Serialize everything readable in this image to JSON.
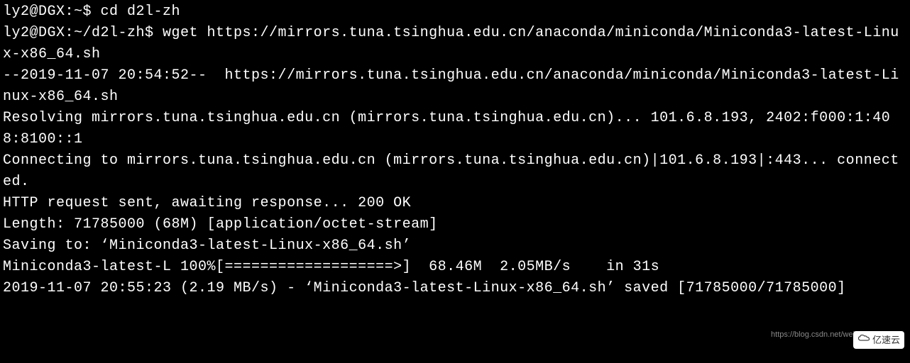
{
  "terminal": {
    "lines": [
      "ly2@DGX:~$ cd d2l-zh",
      "ly2@DGX:~/d2l-zh$ wget https://mirrors.tuna.tsinghua.edu.cn/anaconda/miniconda/Miniconda3-latest-Linux-x86_64.sh",
      "--2019-11-07 20:54:52--  https://mirrors.tuna.tsinghua.edu.cn/anaconda/miniconda/Miniconda3-latest-Linux-x86_64.sh",
      "Resolving mirrors.tuna.tsinghua.edu.cn (mirrors.tuna.tsinghua.edu.cn)... 101.6.8.193, 2402:f000:1:408:8100::1",
      "Connecting to mirrors.tuna.tsinghua.edu.cn (mirrors.tuna.tsinghua.edu.cn)|101.6.8.193|:443... connected.",
      "HTTP request sent, awaiting response... 200 OK",
      "Length: 71785000 (68M) [application/octet-stream]",
      "Saving to: ‘Miniconda3-latest-Linux-x86_64.sh’",
      "",
      "Miniconda3-latest-L 100%[===================>]  68.46M  2.05MB/s    in 31s",
      "",
      "2019-11-07 20:55:23 (2.19 MB/s) - ‘Miniconda3-latest-Linux-x86_64.sh’ saved [71785000/71785000]"
    ]
  },
  "watermark": {
    "text": "https://blog.csdn.net/weixi"
  },
  "logo": {
    "text": "亿速云"
  }
}
